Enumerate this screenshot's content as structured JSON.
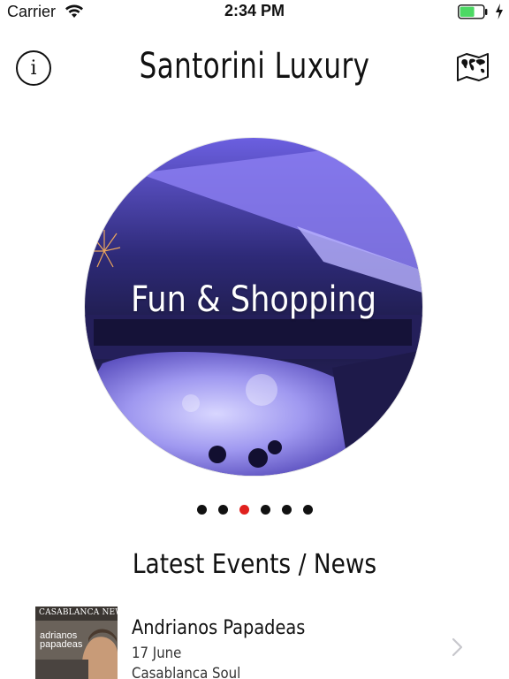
{
  "status_bar": {
    "carrier": "Carrier",
    "time": "2:34 PM",
    "battery_color": "#4cd964"
  },
  "nav": {
    "title": "Santorini Luxury",
    "info_icon_glyph": "i",
    "left_icon": "info-icon",
    "right_icon": "world-map-icon"
  },
  "hero": {
    "label": "Fun & Shopping",
    "image": "nightclub-pool-party-photo"
  },
  "pager": {
    "count": 6,
    "active_index": 2,
    "active_color": "#e0201d"
  },
  "section": {
    "title": "Latest Events / News"
  },
  "events": [
    {
      "title": "Andrianos Papadeas",
      "date": "17 June",
      "subtitle": "Casablanca Soul",
      "thumb_brand": "CASABLANCA NEWS",
      "thumb_name": "adrianos papadeas"
    }
  ]
}
